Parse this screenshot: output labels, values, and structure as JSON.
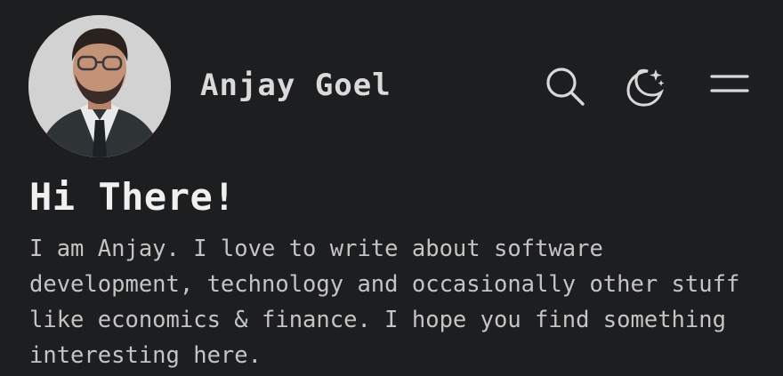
{
  "header": {
    "site_name": "Anjay Goel",
    "avatar_alt": "Anjay Goel profile photo",
    "icons": {
      "search": "search-icon",
      "theme": "moon-icon",
      "menu": "menu-icon"
    }
  },
  "intro": {
    "title": "Hi There!",
    "text": "I am Anjay. I love to write about software development, technology and occasionally other stuff like economics & finance. I hope you find something interesting here."
  },
  "colors": {
    "background": "#1d1e20",
    "primary_text": "#dadadb",
    "secondary_text": "#c4c4c5"
  }
}
